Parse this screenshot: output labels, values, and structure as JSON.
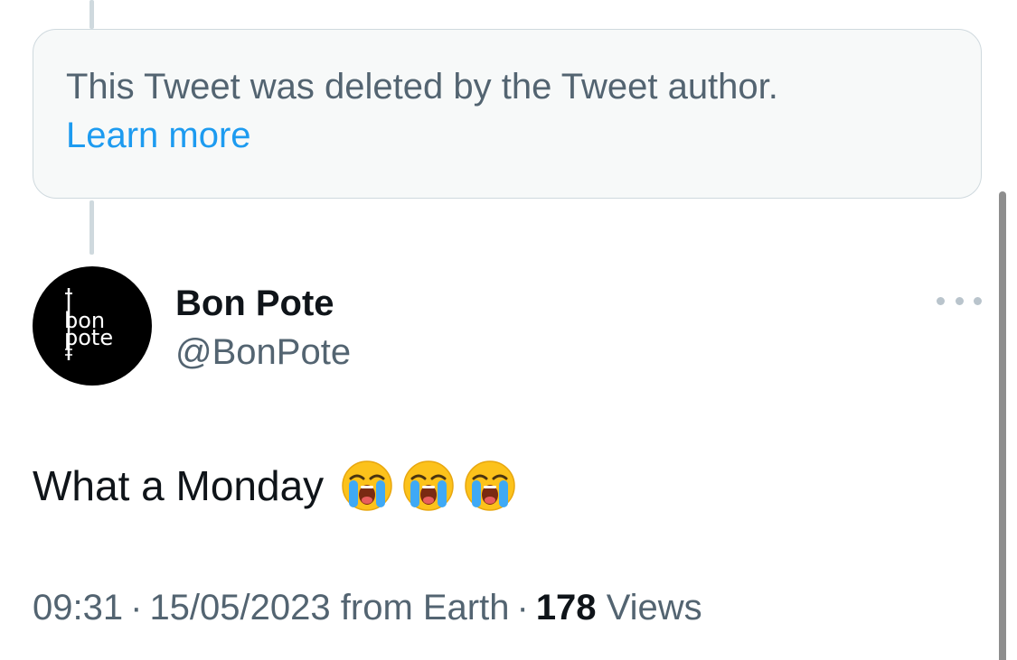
{
  "deleted_notice": {
    "message": "This Tweet was deleted by the Tweet author.",
    "link_label": "Learn more"
  },
  "author": {
    "display_name": "Bon Pote",
    "handle": "@BonPote",
    "avatar_text": "bon pote",
    "avatar_icon": "bon-pote-logo"
  },
  "tweet": {
    "text": "What a Monday",
    "emojis": [
      "loudly-crying-face",
      "loudly-crying-face",
      "loudly-crying-face"
    ]
  },
  "meta": {
    "time": "09:31",
    "separator": "·",
    "date": "15/05/2023",
    "location": "from Earth",
    "views_count": "178",
    "views_label": "Views"
  },
  "icons": {
    "more": "more-horizontal-icon"
  },
  "colors": {
    "link": "#1d9bf0",
    "secondary_text": "#536471",
    "primary_text": "#0f1419",
    "box_background": "#f7f9f9",
    "border": "#cfd9de"
  }
}
